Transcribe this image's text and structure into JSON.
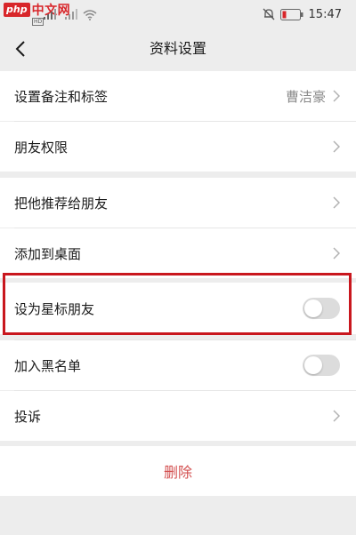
{
  "status_bar": {
    "watermark_badge": "php",
    "watermark_site": "中文网",
    "network_badge": "HD",
    "time": "15:47"
  },
  "nav": {
    "title": "资料设置"
  },
  "settings": {
    "remark": {
      "label": "设置备注和标签",
      "value": "曹洁豪"
    },
    "permissions": {
      "label": "朋友权限"
    },
    "recommend": {
      "label": "把他推荐给朋友"
    },
    "add_to_desktop": {
      "label": "添加到桌面"
    },
    "star_friend": {
      "label": "设为星标朋友",
      "enabled": false
    },
    "blacklist": {
      "label": "加入黑名单",
      "enabled": false
    },
    "complain": {
      "label": "投诉"
    },
    "delete": {
      "label": "删除"
    }
  },
  "colors": {
    "background": "#ededed",
    "highlight_border": "#c9171e",
    "delete_text": "#d34f4f",
    "toggle_off": "#dcdcdc"
  }
}
